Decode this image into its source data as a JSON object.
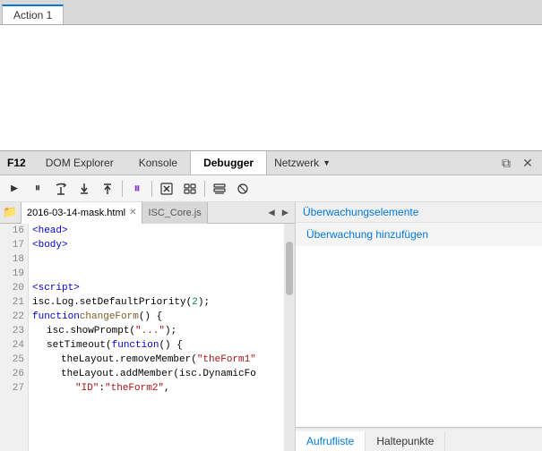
{
  "topTabs": {
    "tabs": [
      {
        "label": "Action 1",
        "active": true
      }
    ]
  },
  "devtools": {
    "f12Label": "F12",
    "tabs": [
      {
        "label": "DOM Explorer",
        "active": false
      },
      {
        "label": "Konsole",
        "active": false
      },
      {
        "label": "Debugger",
        "active": true
      },
      {
        "label": "Netzwerk",
        "active": false,
        "hasDropdown": true
      }
    ],
    "rightIcons": [
      "⧉",
      "✕"
    ]
  },
  "toolbar": {
    "buttons": [
      {
        "icon": "▶",
        "name": "play",
        "title": "Fortsetzen"
      },
      {
        "icon": "⏸",
        "name": "pause",
        "title": "Pause",
        "active": true
      },
      {
        "icon": "⤺",
        "name": "step-over",
        "title": "Schritt über"
      },
      {
        "icon": "⤵",
        "name": "step-into",
        "title": "Schritt hinein"
      },
      {
        "icon": "⤴",
        "name": "step-out",
        "title": "Schritt heraus"
      },
      {
        "separator": true
      },
      {
        "icon": "⬡",
        "name": "breakpoint",
        "title": "Haltepunkt",
        "special": "pause-active"
      },
      {
        "separator": true
      },
      {
        "icon": "⌥",
        "name": "exception",
        "title": "Ausnahme"
      },
      {
        "icon": "⊞",
        "name": "threads",
        "title": "Threads"
      },
      {
        "separator": true
      },
      {
        "icon": "⊟",
        "name": "callstack",
        "title": "Aufrufliste"
      },
      {
        "icon": "⊠",
        "name": "breakpoints",
        "title": "Haltepunkte"
      }
    ]
  },
  "fileTabs": {
    "activeFile": "2016-03-14-mask.html",
    "inactiveFile": "ISC_Core.js",
    "hasClose": true
  },
  "codeLines": [
    {
      "num": 16,
      "code": "<head>",
      "indent": 0
    },
    {
      "num": 17,
      "code": "<body>",
      "indent": 0
    },
    {
      "num": 18,
      "code": "",
      "indent": 0
    },
    {
      "num": 19,
      "code": "",
      "indent": 0
    },
    {
      "num": 20,
      "code": "<script>",
      "indent": 0
    },
    {
      "num": 21,
      "code": "isc.Log.setDefaultPriority(2);",
      "indent": 0
    },
    {
      "num": 22,
      "code": "function changeForm() {",
      "indent": 0
    },
    {
      "num": 23,
      "code": "    isc.showPrompt(\"...\");",
      "indent": 1
    },
    {
      "num": 24,
      "code": "    setTimeout(function () {",
      "indent": 1
    },
    {
      "num": 25,
      "code": "        theLayout.removeMember(\"theForm1\"",
      "indent": 2
    },
    {
      "num": 26,
      "code": "        theLayout.addMember(isc.DynamicFo",
      "indent": 2
    },
    {
      "num": 27,
      "code": "            \"ID\" : \"theForm2\",",
      "indent": 3
    }
  ],
  "rightPanel": {
    "watchHeader": "Überwachungselemente",
    "watchAdd": "Überwachung hinzufügen",
    "bottomTabs": [
      {
        "label": "Aufrufliste",
        "active": true
      },
      {
        "label": "Haltepunkte",
        "active": false
      }
    ]
  }
}
